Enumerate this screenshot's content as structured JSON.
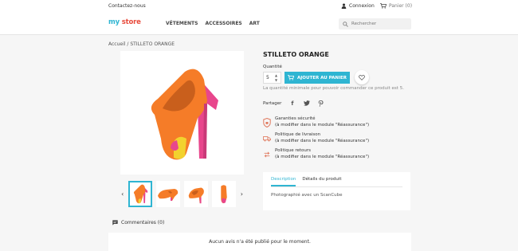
{
  "topbar": {
    "contact": "Contactez-nous",
    "login": "Connexion",
    "cart": "Panier (0)"
  },
  "header": {
    "logo_my": "my",
    "logo_store": "store",
    "nav": [
      "VÊTEMENTS",
      "ACCESSOIRES",
      "ART"
    ],
    "search_placeholder": "Rechercher"
  },
  "breadcrumb": {
    "home": "Accueil",
    "separator": "/",
    "current": "STILLETO ORANGE"
  },
  "product": {
    "title": "STILLETO ORANGE",
    "quantity_label": "Quantité",
    "quantity_value": "5",
    "add_to_cart": "AJOUTER AU PANIER",
    "min_note": "La quantité minimale pour pouvoir commander ce produit est 5.",
    "share_label": "Partager",
    "share_icons": [
      "facebook-icon",
      "twitter-icon",
      "pinterest-icon"
    ]
  },
  "reassurance": [
    {
      "title": "Garanties sécurité",
      "subtitle": "(à modifier dans le module \"Réassurance\")",
      "icon": "security-shield-icon"
    },
    {
      "title": "Politique de livraison",
      "subtitle": "(à modifier dans le module \"Réassurance\")",
      "icon": "delivery-truck-icon"
    },
    {
      "title": "Politique retours",
      "subtitle": "(à modifier dans le module \"Réassurance\")",
      "icon": "return-arrows-icon"
    }
  ],
  "tabs": {
    "items": [
      "Description",
      "Détails du produit"
    ],
    "active": 0,
    "content": "Photographié avec un ScanCube"
  },
  "comments": {
    "header": "Commentaires (0)",
    "empty": "Aucun avis n'a été publié pour le moment."
  },
  "colors": {
    "accent": "#2fb5d2",
    "logo_store": "#e84c3d",
    "shoe_orange": "#f57c28",
    "shoe_pink": "#e8468c",
    "shoe_yellow": "#f2d22e"
  }
}
